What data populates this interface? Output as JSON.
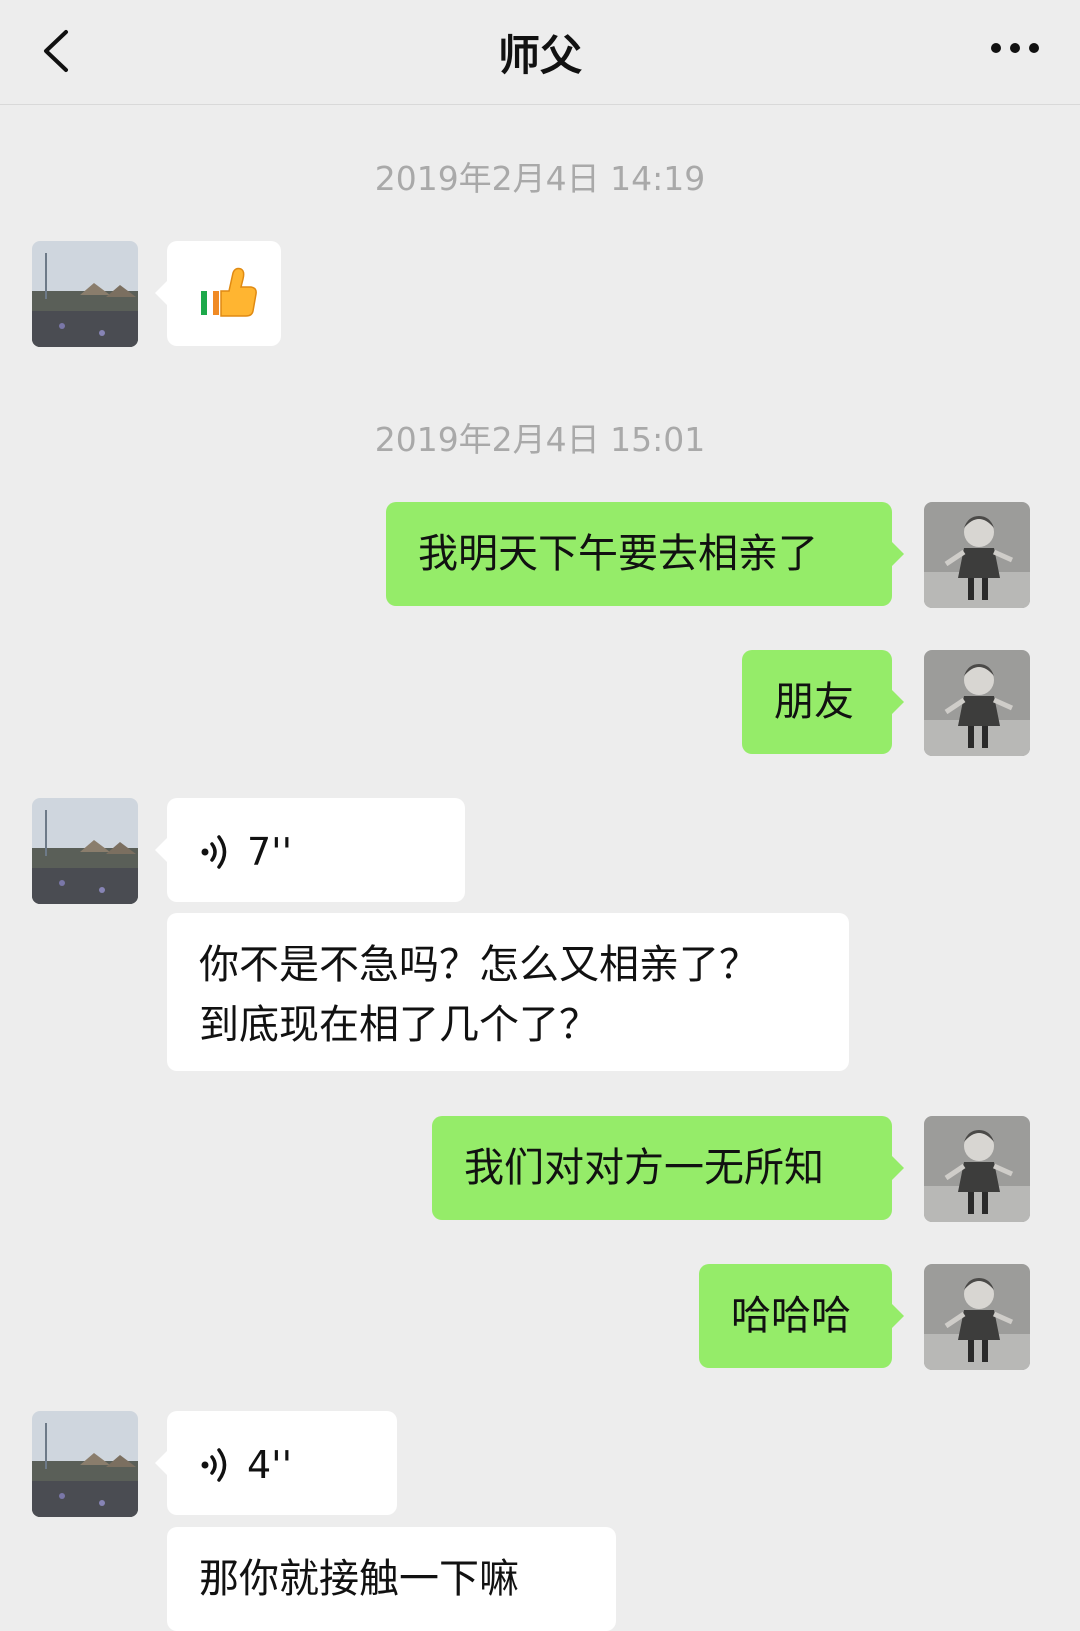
{
  "header": {
    "title": "师父",
    "back_icon": "chevron-left-icon",
    "more_icon": "more-dots-icon"
  },
  "messages": [
    {
      "type": "time",
      "text": "2019年2月4日 14:19"
    },
    {
      "type": "emoji",
      "sender": "other",
      "icon": "thumbs-up-emoji"
    },
    {
      "type": "time",
      "text": "2019年2月4日 15:01"
    },
    {
      "type": "text",
      "sender": "me",
      "text": "我明天下午要去相亲了"
    },
    {
      "type": "text",
      "sender": "me",
      "text": "朋友"
    },
    {
      "type": "voice",
      "sender": "other",
      "duration": "7''"
    },
    {
      "type": "text",
      "sender": "other",
      "line1": "你不是不急吗？怎么又相亲了？",
      "line2": "到底现在相了几个了？"
    },
    {
      "type": "text",
      "sender": "me",
      "text": "我们对对方一无所知"
    },
    {
      "type": "text",
      "sender": "me",
      "text": "哈哈哈"
    },
    {
      "type": "voice",
      "sender": "other",
      "duration": "4''"
    },
    {
      "type": "text",
      "sender": "other",
      "text": "那你就接触一下嘛"
    }
  ],
  "colors": {
    "background": "#ededed",
    "outgoing_bubble": "#95ec69",
    "incoming_bubble": "#ffffff",
    "timestamp": "#a9a9a9"
  }
}
